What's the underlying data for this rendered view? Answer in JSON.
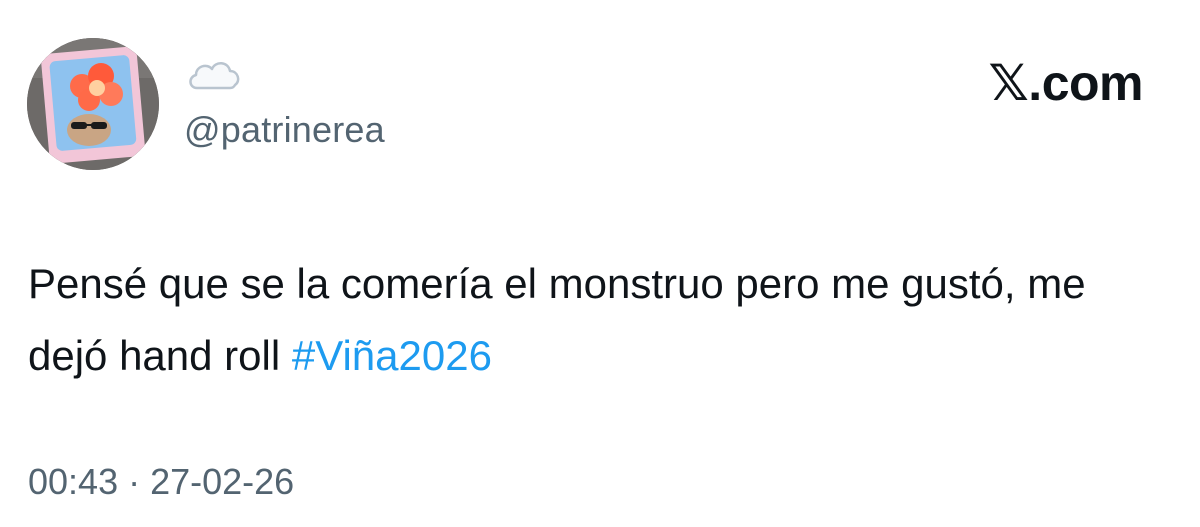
{
  "author": {
    "display_name_icon": "cloud-emoji-icon",
    "handle": "@patrinerea",
    "avatar": "avatar-image"
  },
  "brand": {
    "label": "𝕏.com"
  },
  "tweet": {
    "text": "Pensé que se la comería el monstruo pero me gustó, me dejó hand roll ",
    "hashtag": "#Viña2026",
    "hashtag_color": "#1d9bf0",
    "text_color": "#0f1419"
  },
  "meta": {
    "timestamp": "00:43 · 27-02-26",
    "secondary_color": "#536471"
  }
}
